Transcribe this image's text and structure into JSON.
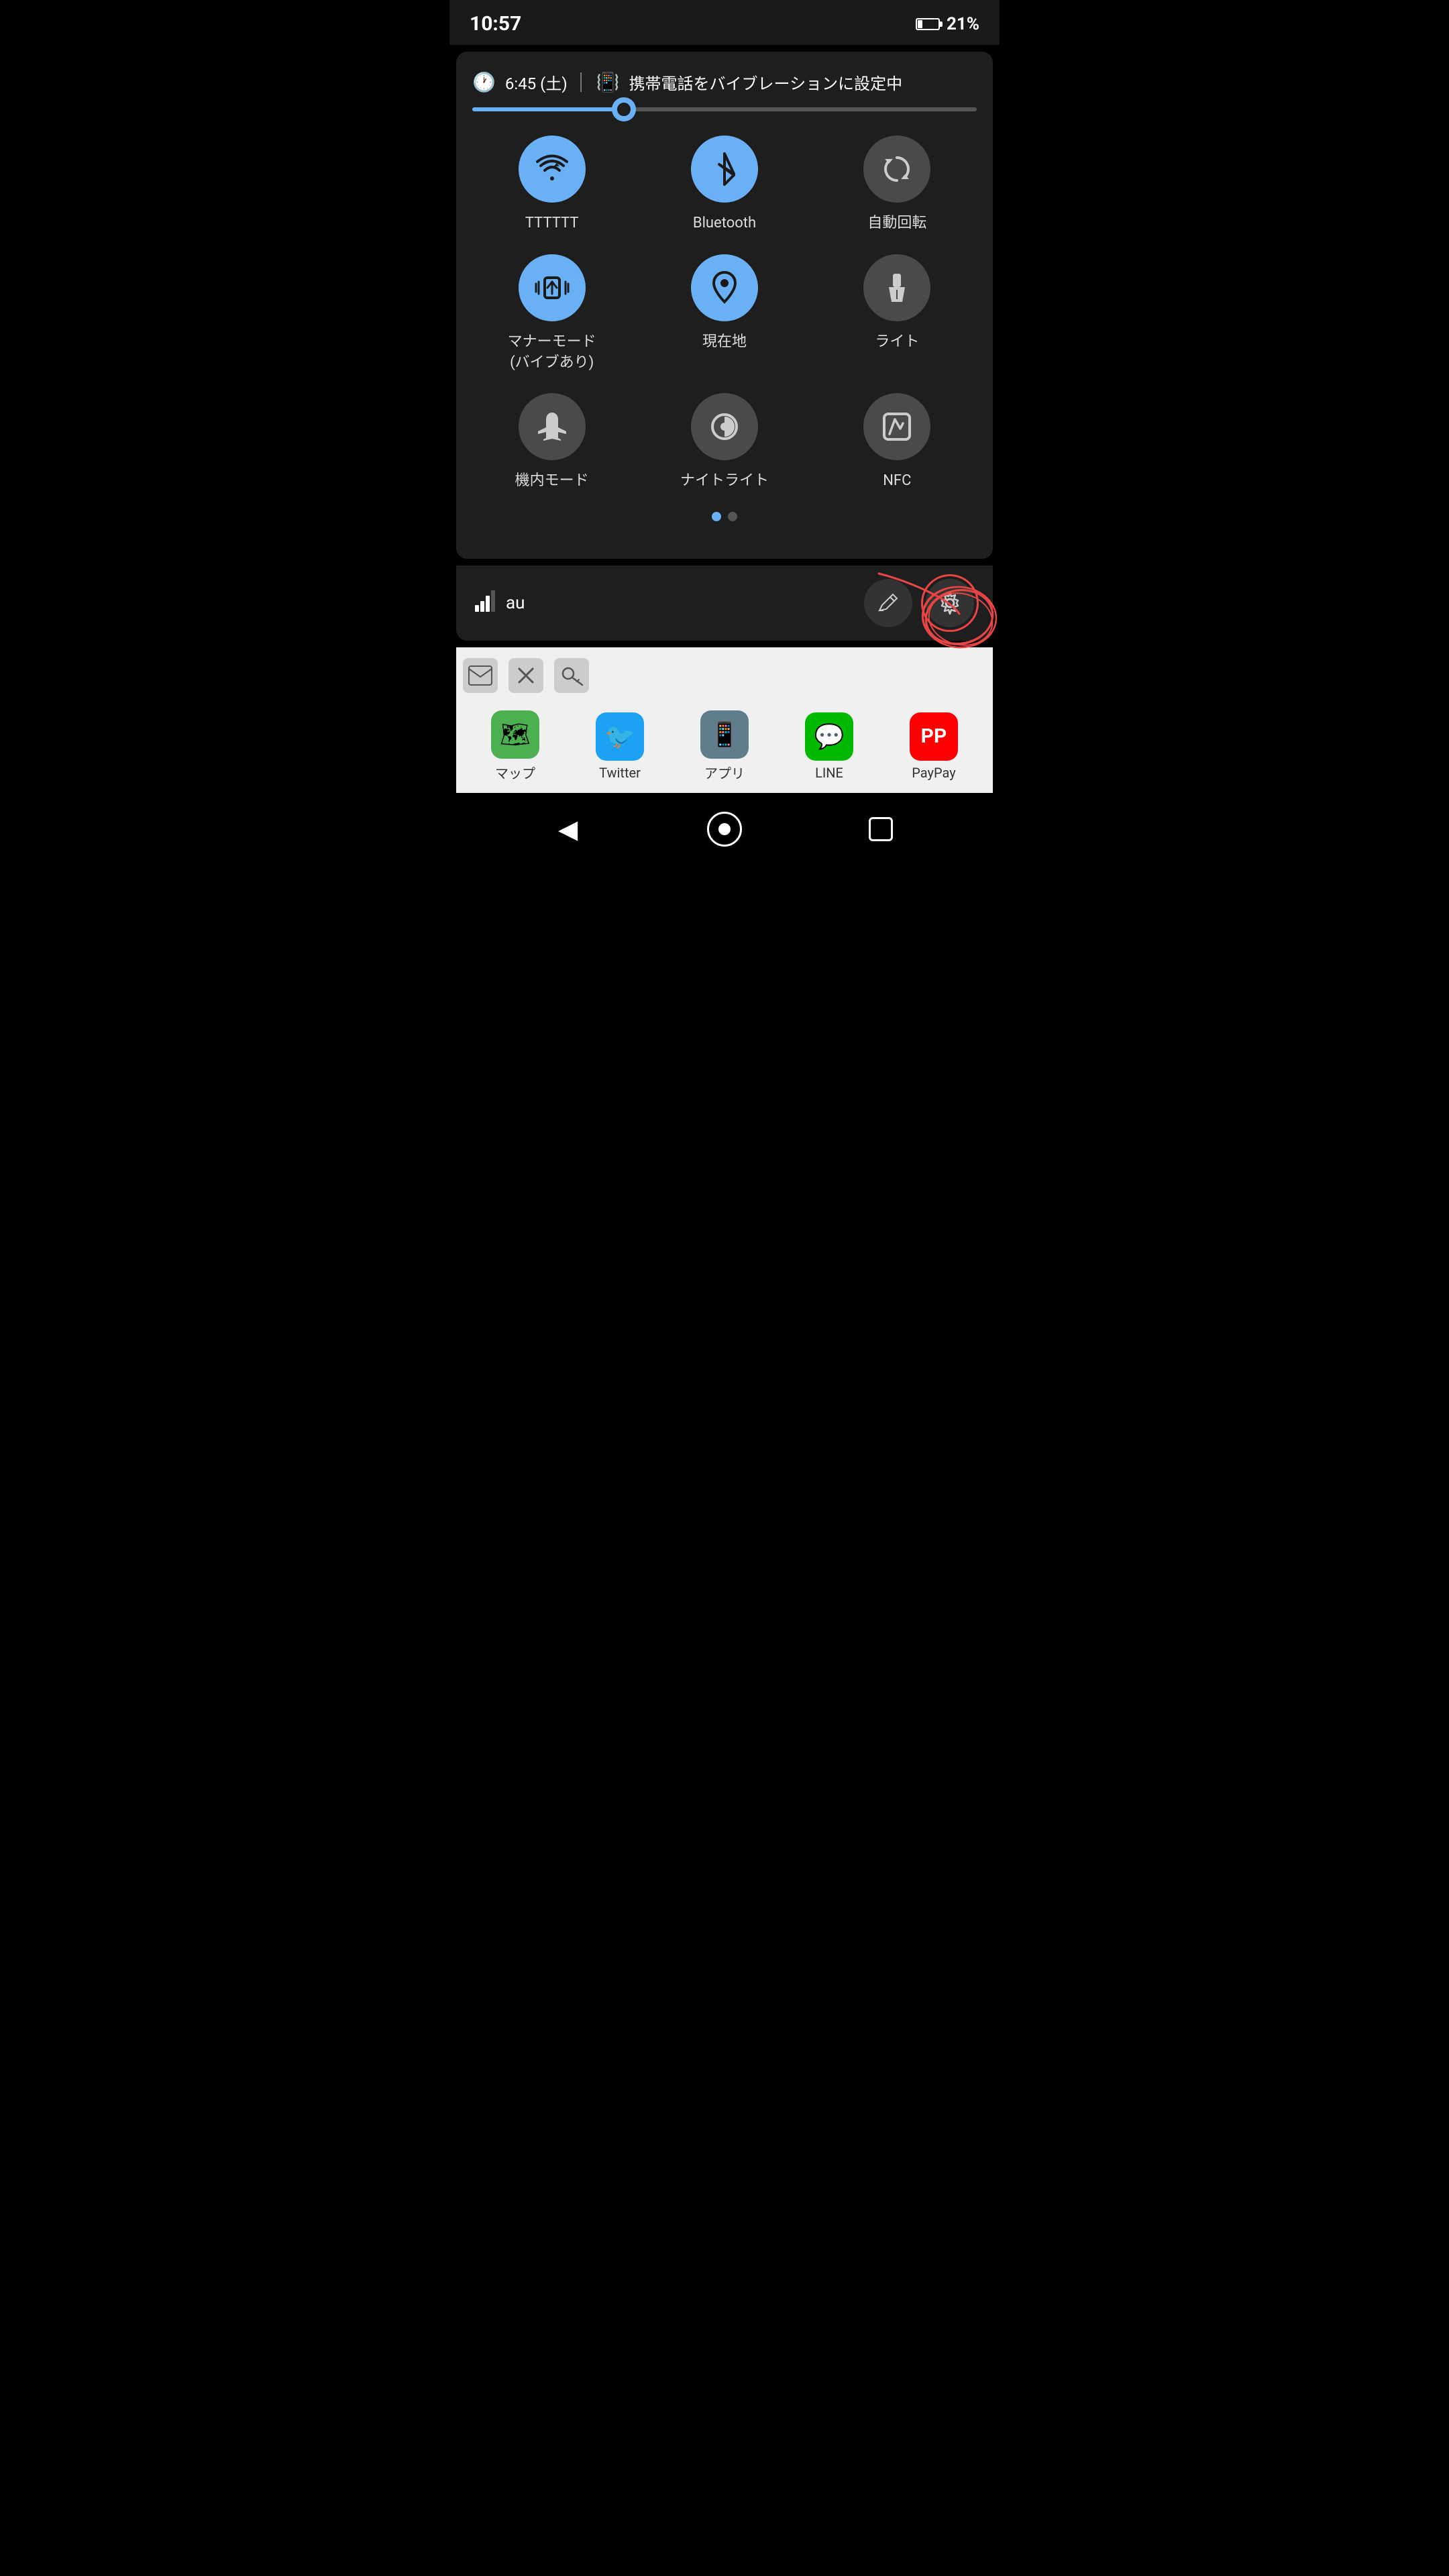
{
  "statusBar": {
    "time": "10:57",
    "battery": "21%",
    "batteryLevel": 21
  },
  "quickPanel": {
    "alarm": {
      "time": "6:45 (土)",
      "vibrationText": "携帯電話をバイブレーションに設定中"
    },
    "brightness": {
      "level": 30
    },
    "toggles": [
      {
        "id": "wifi",
        "label": "TTTTTT",
        "active": true,
        "icon": "wifi"
      },
      {
        "id": "bluetooth",
        "label": "Bluetooth",
        "active": true,
        "icon": "bluetooth"
      },
      {
        "id": "autorotate",
        "label": "自動回転",
        "active": false,
        "icon": "rotate"
      },
      {
        "id": "vibrate",
        "label": "マナーモード\n(バイブあり)",
        "active": true,
        "icon": "vibrate"
      },
      {
        "id": "location",
        "label": "現在地",
        "active": true,
        "icon": "location"
      },
      {
        "id": "flashlight",
        "label": "ライト",
        "active": false,
        "icon": "flashlight"
      },
      {
        "id": "airplane",
        "label": "機内モード",
        "active": false,
        "icon": "airplane"
      },
      {
        "id": "nightlight",
        "label": "ナイトライト",
        "active": false,
        "icon": "nightlight"
      },
      {
        "id": "nfc",
        "label": "NFC",
        "active": false,
        "icon": "nfc"
      }
    ],
    "pagination": {
      "current": 0,
      "total": 2
    },
    "bottomBar": {
      "carrier": "au",
      "editLabel": "✏",
      "settingsLabel": "⚙"
    }
  },
  "appShortcuts": [
    {
      "label": "✉",
      "name": "mail"
    },
    {
      "label": "✂",
      "name": "tools"
    },
    {
      "label": "🔑",
      "name": "key"
    }
  ],
  "dock": [
    {
      "label": "マップ",
      "icon": "🗺",
      "bg": "#4CAF50"
    },
    {
      "label": "Twitter",
      "icon": "🐦",
      "bg": "#1DA1F2"
    },
    {
      "label": "アプリ",
      "icon": "📱",
      "bg": "#607D8B"
    },
    {
      "label": "LINE",
      "icon": "💬",
      "bg": "#00B900"
    },
    {
      "label": "PayPay",
      "icon": "💳",
      "bg": "#FF0000"
    }
  ],
  "navBar": {
    "backLabel": "◀",
    "homeLabel": "●",
    "recentsLabel": "■"
  }
}
